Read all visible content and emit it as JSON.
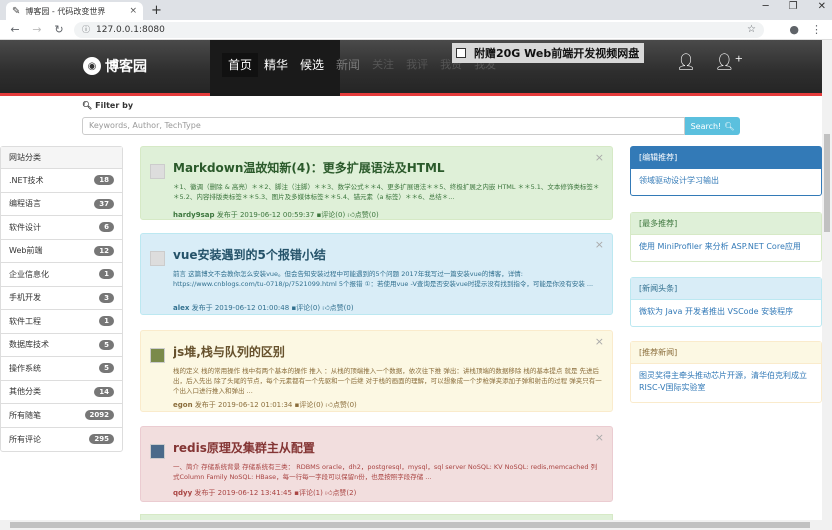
{
  "browser": {
    "tab_title": "博客园 - 代码改变世界",
    "tab_close": "×",
    "new_tab": "+",
    "url": "127.0.0.1:8080",
    "win_min": "─",
    "win_max": "❐",
    "win_close": "✕"
  },
  "header": {
    "logo": "博客园",
    "nav": [
      "首页",
      "精华",
      "候选",
      "新闻",
      "关注",
      "我评",
      "我赞",
      "我发"
    ],
    "ad": "附赠20G Web前端开发视频网盘"
  },
  "filter": {
    "label": "Filter by",
    "placeholder": "Keywords, Author, TechType",
    "button": "Search!"
  },
  "sidebar": {
    "title": "网站分类",
    "items": [
      {
        "label": ".NET技术",
        "count": "18"
      },
      {
        "label": "编程语言",
        "count": "37"
      },
      {
        "label": "软件设计",
        "count": "6"
      },
      {
        "label": "Web前端",
        "count": "12"
      },
      {
        "label": "企业信息化",
        "count": "1"
      },
      {
        "label": "手机开发",
        "count": "3"
      },
      {
        "label": "软件工程",
        "count": "1"
      },
      {
        "label": "数据库技术",
        "count": "5"
      },
      {
        "label": "操作系统",
        "count": "5"
      },
      {
        "label": "其他分类",
        "count": "14"
      },
      {
        "label": "所有随笔",
        "count": "2092"
      },
      {
        "label": "所有评论",
        "count": "295"
      }
    ]
  },
  "posts": [
    {
      "title": "Markdown温故知新(4)：更多扩展语法及HTML",
      "summary": "＊1、徽调（删除 & 高亮）＊＊2、脚注（注脚）＊＊3、数学公式＊＊4、更多扩展语法＊＊5、终极扩展之内嵌 HTML ＊＊5.1、文本修饰类标签＊＊5.2、内容排版类标签＊＊5.3、图片及多媒体标签＊＊5.4、锚元素（a 标签）＊＊6、总结＊...",
      "author": "hardy9sap",
      "posted": "发布于 2019-06-12 00:59:37",
      "comments": "评论(0)",
      "likes": "点赞(0)"
    },
    {
      "title": "vue安装遇到的5个报错小结",
      "summary": "前言 这篇博文不会教你怎么安装vue。但会告知安装过程中可能遇到的5个问题 2017年我写过一篇安装vue的博客，详情: https://www.cnblogs.com/tu-0718/p/7521099.html 5个报错 ①：若使用vue -V查询是否安装vue时提示没有找到指令，可能是你没有安装 ...",
      "author": "alex",
      "posted": "发布于 2019-06-12 01:00:48",
      "comments": "评论(0)",
      "likes": "点赞(0)"
    },
    {
      "title": "js堆,栈与队列的区别",
      "summary": "栈的定义 栈的常用操作 栈中有两个基本的操作 推入 ：从栈的顶端推入一个数据，依次往下推 弹出：讲栈顶端的数据移除 栈的基本提点 就是 先进后出，后入先出 除了头尾的节点，每个元素都有一个先驱和一个后继 对于栈的画面的理解，可以想象成一个步枪弹夹添加子弹和射击的过程 弹夹只有一个出入口进行推入和弹出 ...",
      "author": "egon",
      "posted": "发布于 2019-06-12 01:01:34",
      "comments": "评论(0)",
      "likes": "点赞(0)"
    },
    {
      "title": "redis原理及集群主从配置",
      "summary": "一、简介 存储系统背景 存储系统有三类：  RDBMS oracle，dh2，postgresql，mysql，sql server NoSQL: KV NoSQL: redis,memcached 列式Column Family NoSQL: HBase，每一行每一字段可以保留n份，也是按照字段存储 ...",
      "author": "qdyy",
      "posted": "发布于 2019-06-12 13:41:45",
      "comments": "评论(1)",
      "likes": "点赞(2)"
    }
  ],
  "panels": [
    {
      "title": "[编辑推荐]",
      "body": "领域驱动设计学习输出"
    },
    {
      "title": "[最多推荐]",
      "body": "使用 MiniProfiler 来分析 ASP.NET Core应用"
    },
    {
      "title": "[新闻头条]",
      "body": "微软为 Java 开发者推出 VSCode 安装程序"
    },
    {
      "title": "[推荐新闻]",
      "body": "图灵奖得主牵头推动芯片开源，清华伯克利成立RISC-V国际实验室"
    }
  ],
  "colors": {
    "accent_red": "#e53c3c",
    "search_button": "#5bc0de",
    "link": "#337ab7"
  }
}
